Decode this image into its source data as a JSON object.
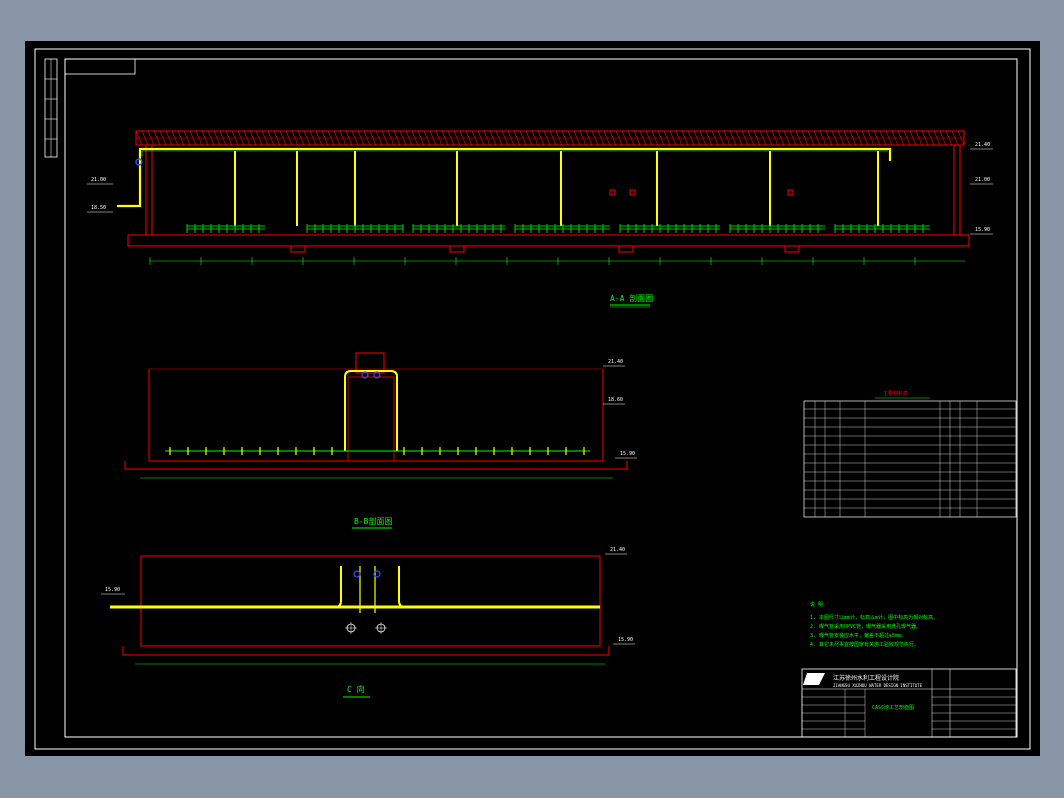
{
  "drawing": {
    "section_aa": "A-A 剖面图",
    "section_bb": "B-B剖面图",
    "view_c": "C 向",
    "materials_title": "主要材料表",
    "notes_title": "说 明",
    "notes": [
      "1. 本图尺寸以mm计，标高以m计，图中标高为相对标高。",
      "2. 曝气管采用UPVC管，曝气器采用微孔曝气器。",
      "3. 曝气管安装应水平，偏差不超过±5mm。",
      "4. 其它未尽事宜按国家有关施工验收规范执行。"
    ],
    "company_cn": "江苏徐州水利工程设计院",
    "company_en": "JIANGSU XUZHOU WATER DESIGN INSTITUTE",
    "drawing_name": "CASS池工艺剖面图",
    "levels": {
      "aa_top": "21.40",
      "aa_mid": "21.00",
      "aa_low": "18.50",
      "aa_bottom": "15.90",
      "bb_top": "21.40",
      "bb_mid": "18.60",
      "bb_bottom": "15.90",
      "c_top": "21.40",
      "c_pipe": "15.90",
      "c_bottom": "15.90"
    },
    "colors": {
      "background": "#000000",
      "frame": "#ffffff",
      "wall": "#ff0000",
      "pipe": "#ffff00",
      "text": "#00ff00"
    }
  }
}
